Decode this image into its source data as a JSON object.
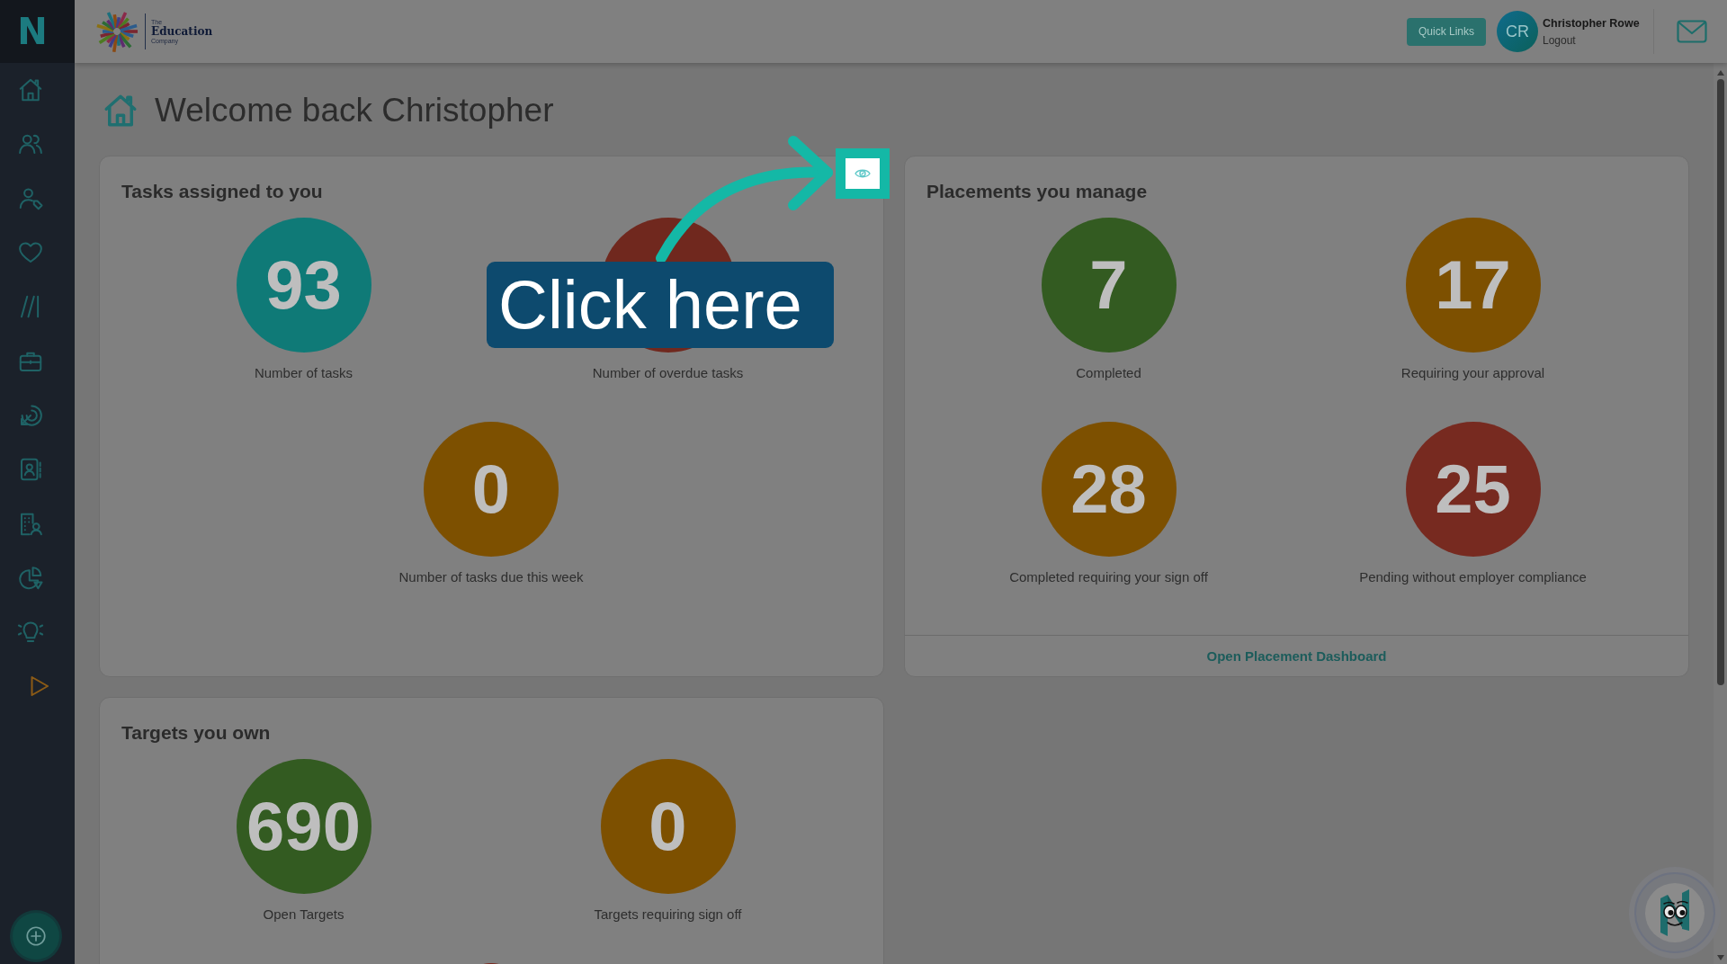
{
  "sidebar": {
    "logo": "N"
  },
  "header": {
    "brand": {
      "prefix": "The",
      "name": "Education",
      "suffix": "Company"
    },
    "quick_links": "Quick Links",
    "user": {
      "initials": "CR",
      "name": "Christopher Rowe",
      "logout": "Logout"
    }
  },
  "page": {
    "title": "Welcome back Christopher"
  },
  "cards": [
    {
      "title": "Tasks assigned to you",
      "stats": [
        {
          "value": "93",
          "label": "Number of tasks",
          "color": "#0f7a77"
        },
        {
          "label": "Number of overdue tasks",
          "color": "#70281e"
        },
        {
          "value": "0",
          "label": "Number of tasks due this week",
          "color": "#7d5000"
        }
      ]
    },
    {
      "title": "Placements you manage",
      "stats": [
        {
          "value": "7",
          "label": "Completed",
          "color": "#335b21"
        },
        {
          "value": "17",
          "label": "Requiring your approval",
          "color": "#7d5000"
        },
        {
          "value": "28",
          "label": "Completed requiring your sign off",
          "color": "#7d5000"
        },
        {
          "value": "25",
          "label": "Pending without employer compliance",
          "color": "#772a20"
        }
      ],
      "footer_link": "Open Placement Dashboard"
    },
    {
      "title": "Targets you own",
      "stats": [
        {
          "value": "690",
          "label": "Open Targets",
          "color": "#335b21"
        },
        {
          "value": "0",
          "label": "Targets requiring sign off",
          "color": "#7d5000"
        },
        {
          "color": "#772a20"
        }
      ]
    }
  ],
  "tour": {
    "callout": "Click here"
  }
}
